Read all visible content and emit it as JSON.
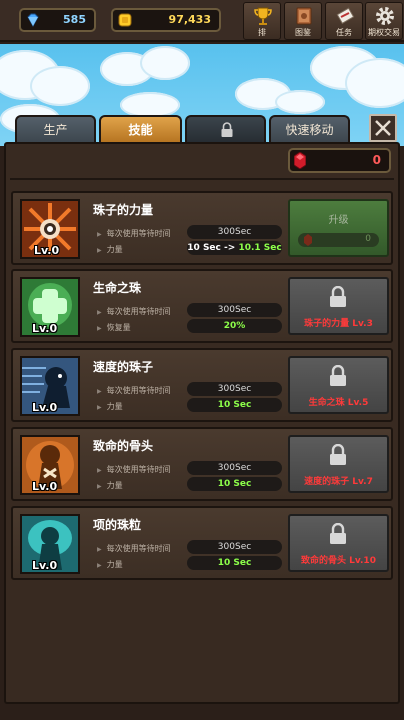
{
  "currencies": {
    "gems": "585",
    "coins": "97,433"
  },
  "top_menu": [
    {
      "label": "排",
      "icon": "trophy-icon"
    },
    {
      "label": "图鉴",
      "icon": "book-icon"
    },
    {
      "label": "任务",
      "icon": "scroll-icon"
    },
    {
      "label": "期权交易",
      "icon": "gear-icon"
    }
  ],
  "tabs": [
    {
      "label": "生产",
      "active": false
    },
    {
      "label": "技能",
      "active": true
    },
    {
      "label": "",
      "icon": "lock-icon",
      "locked": true
    },
    {
      "label": "快速移动",
      "active": false
    }
  ],
  "rubies": "0",
  "skills": [
    {
      "name": "珠子的力量",
      "level": "Lv.0",
      "stat1_label": "每次使用等待时间",
      "stat1_value": "300Sec",
      "stat2_label": "力量",
      "stat2_from": "10 Sec",
      "stat2_arrow": "->",
      "stat2_to": "10.1 Sec",
      "action": {
        "type": "upgrade",
        "label": "升级",
        "cost": "0"
      }
    },
    {
      "name": "生命之珠",
      "level": "Lv.0",
      "stat1_label": "每次使用等待时间",
      "stat1_value": "300Sec",
      "stat2_label": "恢复量",
      "stat2_value": "20%",
      "action": {
        "type": "locked",
        "requirement": "珠子的力量 Lv.3"
      }
    },
    {
      "name": "速度的珠子",
      "level": "Lv.0",
      "stat1_label": "每次使用等待时间",
      "stat1_value": "300Sec",
      "stat2_label": "力量",
      "stat2_value": "10 Sec",
      "action": {
        "type": "locked",
        "requirement": "生命之珠 Lv.5"
      }
    },
    {
      "name": "致命的骨头",
      "level": "Lv.0",
      "stat1_label": "每次使用等待时间",
      "stat1_value": "300Sec",
      "stat2_label": "力量",
      "stat2_value": "10 Sec",
      "action": {
        "type": "locked",
        "requirement": "速度的珠子 Lv.7"
      }
    },
    {
      "name": "项的珠粒",
      "level": "Lv.0",
      "stat1_label": "每次使用等待时间",
      "stat1_value": "300Sec",
      "stat2_label": "力量",
      "stat2_value": "10 Sec",
      "action": {
        "type": "locked",
        "requirement": "致命的骨头 Lv.10"
      }
    }
  ],
  "colors": {
    "accent_tab": "#d9963a",
    "lock_text": "#ff3a3a",
    "value_green": "#8dff4a",
    "ruby": "#ff5a5a"
  }
}
